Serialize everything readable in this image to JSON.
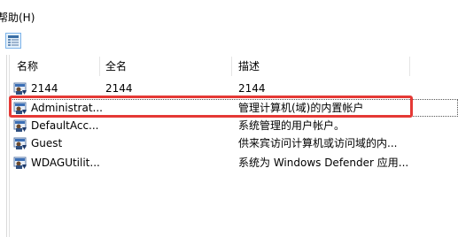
{
  "menubar": {
    "help_label": "帮助(H)"
  },
  "toolbar": {
    "view_button_icon": "details-view-icon"
  },
  "list": {
    "columns": [
      {
        "label": "名称"
      },
      {
        "label": "全名"
      },
      {
        "label": "描述"
      }
    ],
    "rows": [
      {
        "name": "2144",
        "full_name": "2144",
        "description": "2144",
        "icon": "user-icon"
      },
      {
        "name": "Administrat...",
        "full_name": "",
        "description": "管理计算机(域)的内置帐户",
        "icon": "user-icon"
      },
      {
        "name": "DefaultAcc...",
        "full_name": "",
        "description": "系统管理的用户帐户。",
        "icon": "user-icon"
      },
      {
        "name": "Guest",
        "full_name": "",
        "description": "供来宾访问计算机或访问域的内...",
        "icon": "user-icon"
      },
      {
        "name": "WDAGUtilit...",
        "full_name": "",
        "description": "系统为 Windows Defender 应用...",
        "icon": "user-icon"
      }
    ]
  },
  "annotation": {
    "highlight_color": "#e53935"
  }
}
